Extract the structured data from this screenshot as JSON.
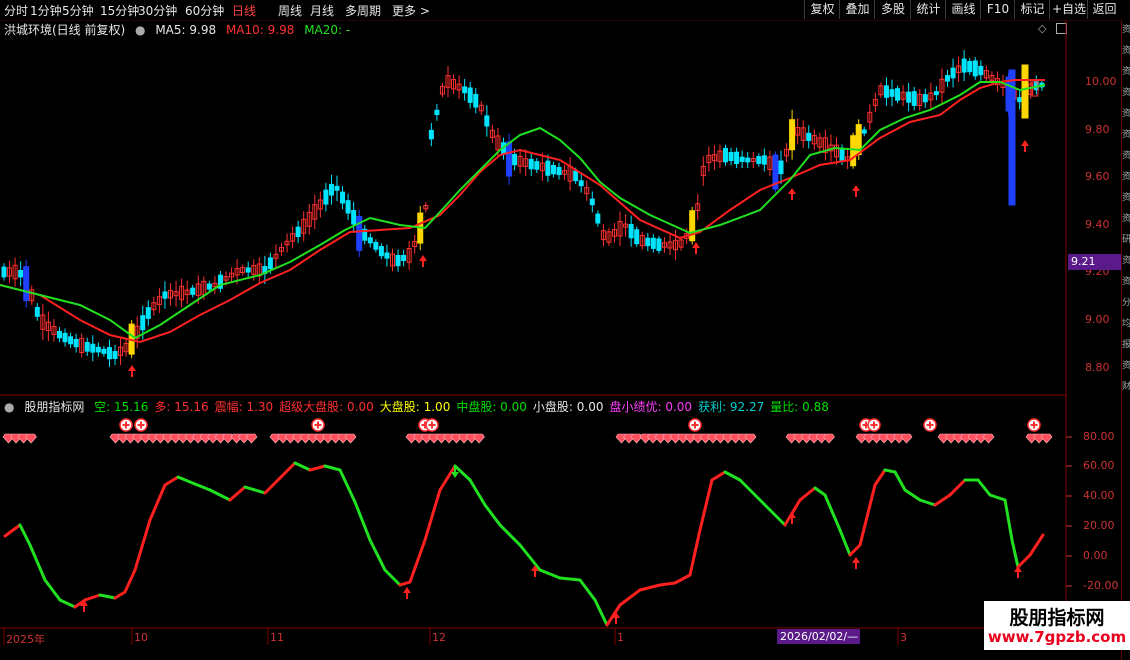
{
  "toolbar": {
    "periods": [
      "分时",
      "1分钟",
      "5分钟",
      "15分钟",
      "30分钟",
      "60分钟",
      "日线",
      "周线",
      "月线",
      "多周期",
      "更多"
    ],
    "active": "日线",
    "right_buttons": [
      "复权",
      "叠加",
      "多股",
      "统计",
      "画线",
      "F10",
      "标记",
      "+自选",
      "返回"
    ]
  },
  "price_panel": {
    "title": "洪城环境(日线 前复权)",
    "ma5": "MA5: 9.98",
    "ma10": "MA10: 9.98",
    "ma20": "MA20: -",
    "axis_labels": [
      "10.00",
      "9.80",
      "9.60",
      "9.40",
      "9.20",
      "9.00",
      "8.80"
    ],
    "current_price": "9.21"
  },
  "indicator_panel": {
    "title": "股朋指标网",
    "items": [
      {
        "label": "空: 15.16",
        "color": "#00e000"
      },
      {
        "label": "多: 15.16",
        "color": "#ff3030"
      },
      {
        "label": "震幅: 1.30",
        "color": "#ff3030"
      },
      {
        "label": "超级大盘股: 0.00",
        "color": "#ff3030"
      },
      {
        "label": "大盘股: 1.00",
        "color": "#ffff00"
      },
      {
        "label": "中盘股: 0.00",
        "color": "#00e000"
      },
      {
        "label": "小盘股: 0.00",
        "color": "#e6e6e6"
      },
      {
        "label": "盘小绩优: 0.00",
        "color": "#ff40ff"
      },
      {
        "label": "获利: 92.27",
        "color": "#00d0d0"
      },
      {
        "label": "量比: 0.88",
        "color": "#00e000"
      }
    ],
    "axis_labels": [
      "80.00",
      "60.00",
      "40.00",
      "20.00",
      "0.00",
      "-20.00"
    ]
  },
  "date_axis": {
    "labels": [
      "2025年",
      "10",
      "11",
      "12",
      "1",
      "3"
    ],
    "cursor_date": "2026/02/02/—"
  },
  "right_column_chars": [
    "资",
    "资",
    "资",
    "资",
    "资",
    "资",
    "资",
    "资",
    "资",
    "资",
    "研",
    "资",
    "资",
    "分",
    "均",
    "报",
    "资",
    "财"
  ],
  "watermark": {
    "name": "股朋指标网",
    "url": "www.7gpzb.com"
  },
  "colors": {
    "up": "#ff3030",
    "down": "#00e5ff",
    "ma_red": "#ff2020",
    "ma_green": "#20e020",
    "signal_yellow": "#ffd700",
    "signal_blue": "#2040ff"
  }
}
